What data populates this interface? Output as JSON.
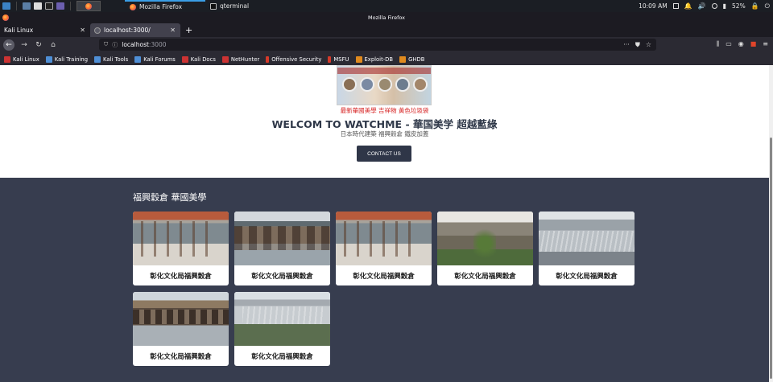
{
  "taskbar": {
    "windows": [
      "Mozilla Firefox",
      "qterminal"
    ],
    "clock": "10:09 AM",
    "battery": "52%"
  },
  "window": {
    "title": "Mozilla Firefox"
  },
  "tabs": [
    {
      "label": "Kali Linux",
      "active": false
    },
    {
      "label": "localhost:3000/",
      "active": true
    }
  ],
  "url": {
    "host": "localhost",
    "port": ":3000"
  },
  "bookmarks": [
    {
      "label": "Kali Linux",
      "icon": "kali-icon"
    },
    {
      "label": "Kali Training",
      "icon": "kali-training-icon"
    },
    {
      "label": "Kali Tools",
      "icon": "kali-tools-icon"
    },
    {
      "label": "Kali Forums",
      "icon": "kali-forums-icon"
    },
    {
      "label": "Kali Docs",
      "icon": "kali-docs-icon"
    },
    {
      "label": "NetHunter",
      "icon": "nethunter-icon"
    },
    {
      "label": "Offensive Security",
      "icon": "offsec-icon"
    },
    {
      "label": "MSFU",
      "icon": "msfu-icon"
    },
    {
      "label": "Exploit-DB",
      "icon": "exploitdb-icon"
    },
    {
      "label": "GHDB",
      "icon": "ghdb-icon"
    }
  ],
  "hero": {
    "poster_caption": "最新華國美學 吉祥物 黃色垃圾袋",
    "title": "WELCOM TO WATCHME - 華国美学 超越藍綠",
    "subtitle": "日本時代建築 福興穀倉 鐵皮加蓋",
    "contact_label": "CONTACT US"
  },
  "gallery": {
    "title": "福興穀倉 華國美學",
    "cards": [
      {
        "caption": "彰化文化局福興穀倉"
      },
      {
        "caption": "彰化文化局福興穀倉"
      },
      {
        "caption": "彰化文化局福興穀倉"
      },
      {
        "caption": "彰化文化局福興穀倉"
      },
      {
        "caption": "彰化文化局福興穀倉"
      },
      {
        "caption": "彰化文化局福興穀倉"
      },
      {
        "caption": "彰化文化局福興穀倉"
      }
    ]
  },
  "colors": {
    "gallery_bg": "#373d4f",
    "button_bg": "#2f3648",
    "poster_caption": "#d62020",
    "hero_title": "#2e3748"
  }
}
